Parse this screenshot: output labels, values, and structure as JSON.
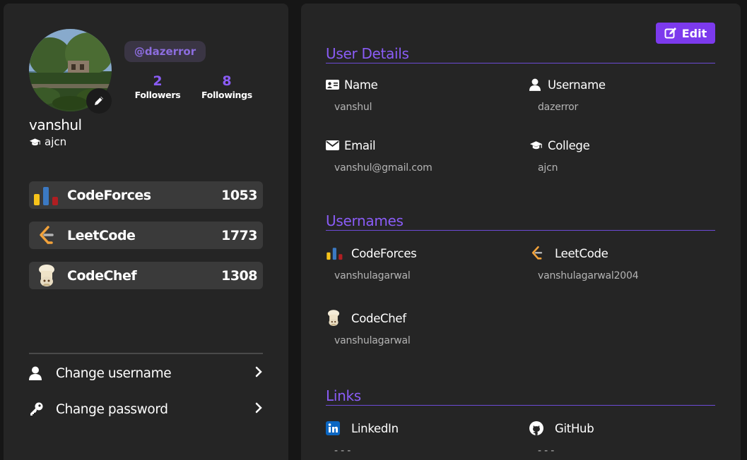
{
  "profile": {
    "handle": "@dazerror",
    "followers_count": "2",
    "followers_label": "Followers",
    "followings_count": "8",
    "followings_label": "Followings",
    "display_name": "vanshul",
    "college": "ajcn"
  },
  "platforms": [
    {
      "name": "CodeForces",
      "rating": "1053",
      "icon": "codeforces-icon"
    },
    {
      "name": "LeetCode",
      "rating": "1773",
      "icon": "leetcode-icon"
    },
    {
      "name": "CodeChef",
      "rating": "1308",
      "icon": "codechef-icon"
    }
  ],
  "menu": {
    "change_username": "Change username",
    "change_password": "Change password"
  },
  "details": {
    "edit_label": "Edit",
    "user_details_title": "User Details",
    "name_label": "Name",
    "name_value": "vanshul",
    "username_label": "Username",
    "username_value": "dazerror",
    "email_label": "Email",
    "email_value": "vanshul@gmail.com",
    "college_label": "College",
    "college_value": "ajcn",
    "usernames_title": "Usernames",
    "codeforces_label": "CodeForces",
    "codeforces_value": "vanshulagarwal",
    "leetcode_label": "LeetCode",
    "leetcode_value": "vanshulagarwal2004",
    "codechef_label": "CodeChef",
    "codechef_value": "vanshulagarwal",
    "links_title": "Links",
    "linkedin_label": "LinkedIn",
    "linkedin_value": "- - -",
    "github_label": "GitHub",
    "github_value": "- - -"
  },
  "colors": {
    "accent": "#8a5cf6",
    "button": "#7c3aed",
    "panel": "#252525",
    "background": "#161616"
  }
}
